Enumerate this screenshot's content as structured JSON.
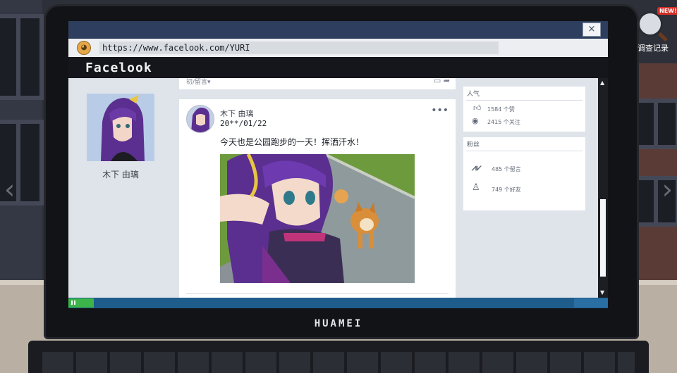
{
  "browser": {
    "close_label": "×",
    "url": "https://www.facelook.com/YURI"
  },
  "site": {
    "logo": "Facelook"
  },
  "profile": {
    "name": "木下 由璃"
  },
  "post_top": {
    "partial_text": "初/留言▾",
    "icons": [
      "comment-icon",
      "share-icon"
    ]
  },
  "post": {
    "author": "木下 由璃",
    "date": "20**/01/22",
    "more": "•••",
    "text": "今天也是公园跑步的一天！挥洒汗水！"
  },
  "popular": {
    "title": "人气",
    "likes": "1584 个赞",
    "follows": "2415 个关注"
  },
  "fans": {
    "title": "粉丝",
    "comments": "485 个留言",
    "friends": "749 个好友"
  },
  "laptop": {
    "brand": "HUAMEI"
  },
  "investigation": {
    "label": "调查记录",
    "badge": "NEW!"
  },
  "nav": {
    "left": "‹",
    "right": "›"
  }
}
